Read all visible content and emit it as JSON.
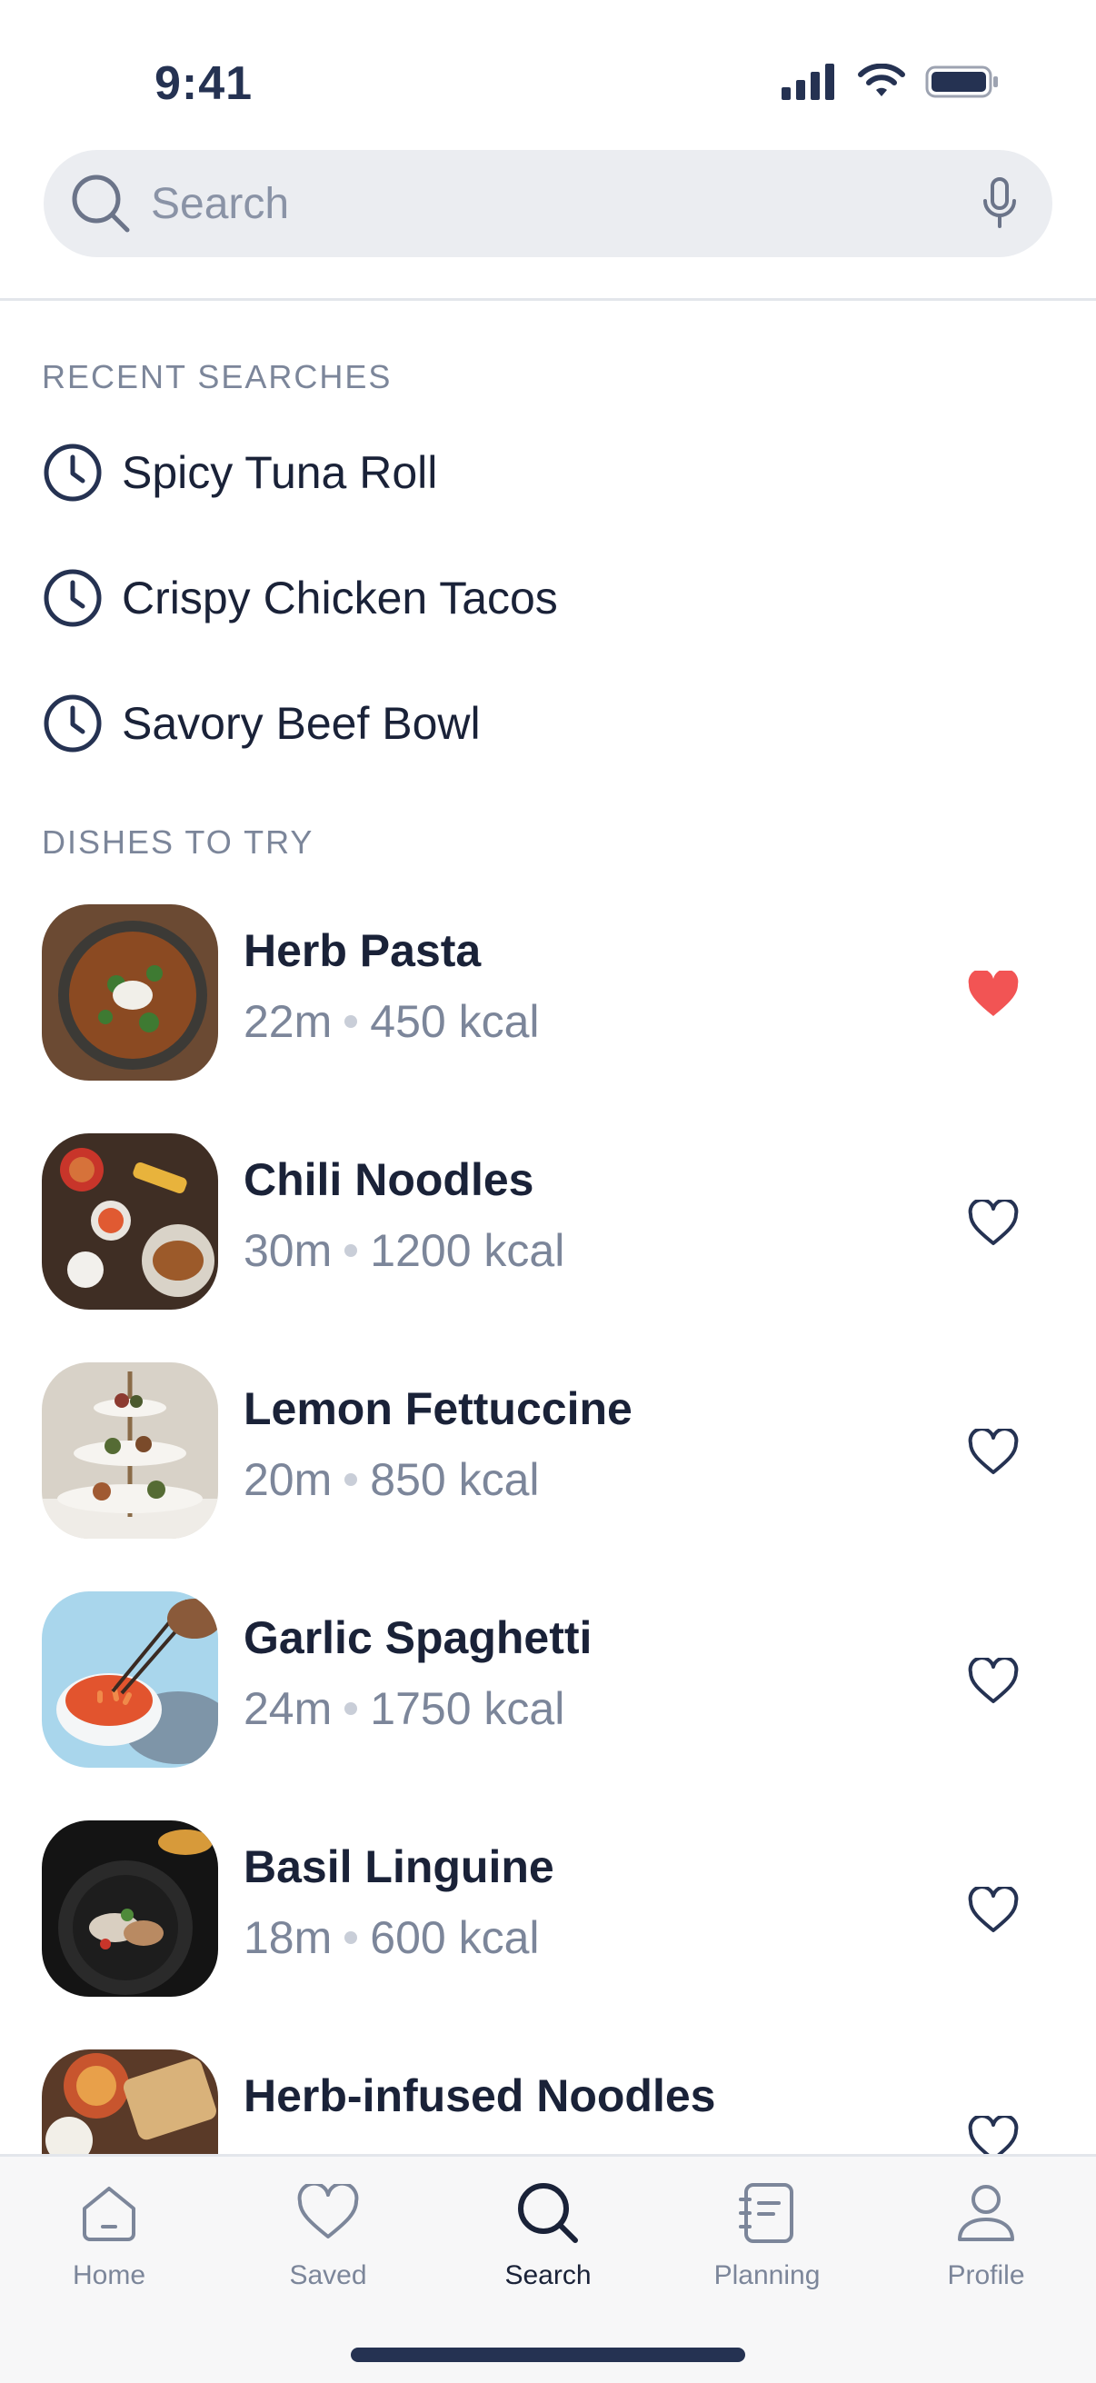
{
  "status_bar": {
    "time": "9:41",
    "icons": [
      "cellular-signal-icon",
      "wifi-icon",
      "battery-icon"
    ]
  },
  "search": {
    "placeholder": "Search",
    "value": "",
    "icons": [
      "search-icon",
      "microphone-icon"
    ]
  },
  "recent": {
    "title": "RECENT SEARCHES",
    "items": [
      {
        "label": "Spicy Tuna Roll",
        "icon": "clock-icon"
      },
      {
        "label": "Crispy Chicken Tacos",
        "icon": "clock-icon"
      },
      {
        "label": "Savory Beef Bowl",
        "icon": "clock-icon"
      }
    ]
  },
  "dishes": {
    "title": "DISHES TO TRY",
    "items": [
      {
        "name": "Herb Pasta",
        "time": "22m",
        "calories": "450 kcal",
        "favorited": true
      },
      {
        "name": "Chili Noodles",
        "time": "30m",
        "calories": "1200 kcal",
        "favorited": false
      },
      {
        "name": "Lemon Fettuccine",
        "time": "20m",
        "calories": "850 kcal",
        "favorited": false
      },
      {
        "name": "Garlic Spaghetti",
        "time": "24m",
        "calories": "1750 kcal",
        "favorited": false
      },
      {
        "name": "Basil Linguine",
        "time": "18m",
        "calories": "600 kcal",
        "favorited": false
      },
      {
        "name": "Herb-infused Noodles",
        "time": "",
        "calories": "",
        "favorited": false
      }
    ]
  },
  "tabs": [
    {
      "label": "Home",
      "icon": "home-icon",
      "active": false
    },
    {
      "label": "Saved",
      "icon": "heart-icon",
      "active": false
    },
    {
      "label": "Search",
      "icon": "search-icon",
      "active": true
    },
    {
      "label": "Planning",
      "icon": "notebook-icon",
      "active": false
    },
    {
      "label": "Profile",
      "icon": "person-icon",
      "active": false
    }
  ],
  "colors": {
    "text_primary": "#1a2238",
    "text_secondary": "#7c869a",
    "search_bg": "#ebedf1",
    "heart_active": "#f25454",
    "icon_dark": "#253252"
  }
}
